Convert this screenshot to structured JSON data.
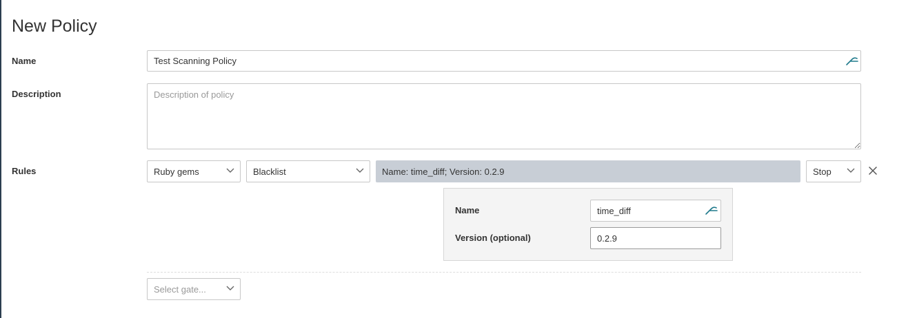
{
  "page": {
    "title": "New Policy"
  },
  "form": {
    "name_label": "Name",
    "name_value": "Test Scanning Policy",
    "description_label": "Description",
    "description_placeholder": "Description of policy",
    "rules_label": "Rules"
  },
  "rule": {
    "gate": "Ruby gems",
    "trigger": "Blacklist",
    "summary": "Name: time_diff; Version: 0.2.9",
    "action": "Stop",
    "params": {
      "name_label": "Name",
      "name_value": "time_diff",
      "version_label": "Version (optional)",
      "version_value": "0.2.9"
    }
  },
  "new_rule": {
    "gate_placeholder": "Select gate..."
  },
  "icons": {
    "key": "key-icon",
    "dropdown": "chevron-down-icon",
    "remove": "close-icon"
  },
  "colors": {
    "accent": "#1f7a8c",
    "summary_bg": "#c8ced6",
    "panel_bg": "#f4f4f4"
  }
}
